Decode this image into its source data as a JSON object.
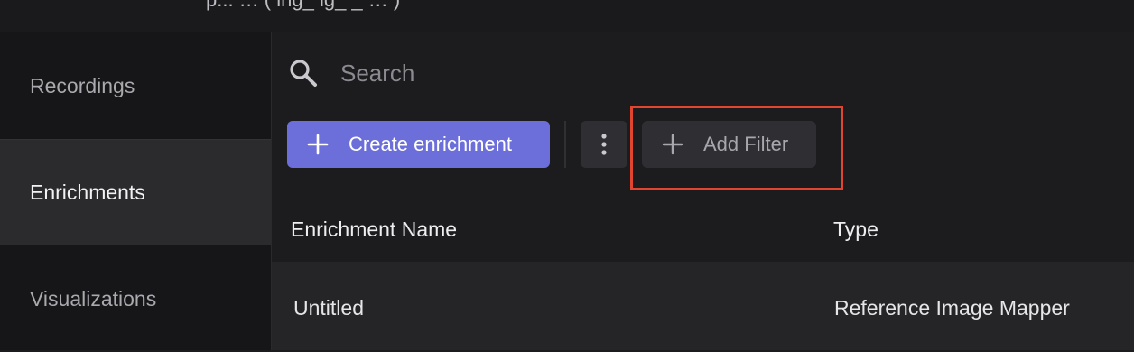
{
  "header": {
    "title_fragment": "p...  … ( ing_ ig_  _ … )"
  },
  "sidebar": {
    "items": [
      {
        "label": "Recordings",
        "active": false
      },
      {
        "label": "Enrichments",
        "active": true
      },
      {
        "label": "Visualizations",
        "active": false
      }
    ]
  },
  "search": {
    "placeholder": "Search",
    "value": "",
    "icon": "search-icon"
  },
  "toolbar": {
    "create_label": "Create enrichment",
    "create_icon": "plus-icon",
    "more_icon": "more-vertical-icon",
    "filter_label": "Add Filter",
    "filter_icon": "plus-icon"
  },
  "table": {
    "columns": [
      "Enrichment Name",
      "Type"
    ],
    "rows": [
      [
        "Untitled",
        "Reference Image Mapper"
      ]
    ]
  },
  "colors": {
    "accent": "#6c6fd9",
    "highlight": "#e2452f",
    "background": "#1c1c1e",
    "sidebar": "#161618"
  }
}
